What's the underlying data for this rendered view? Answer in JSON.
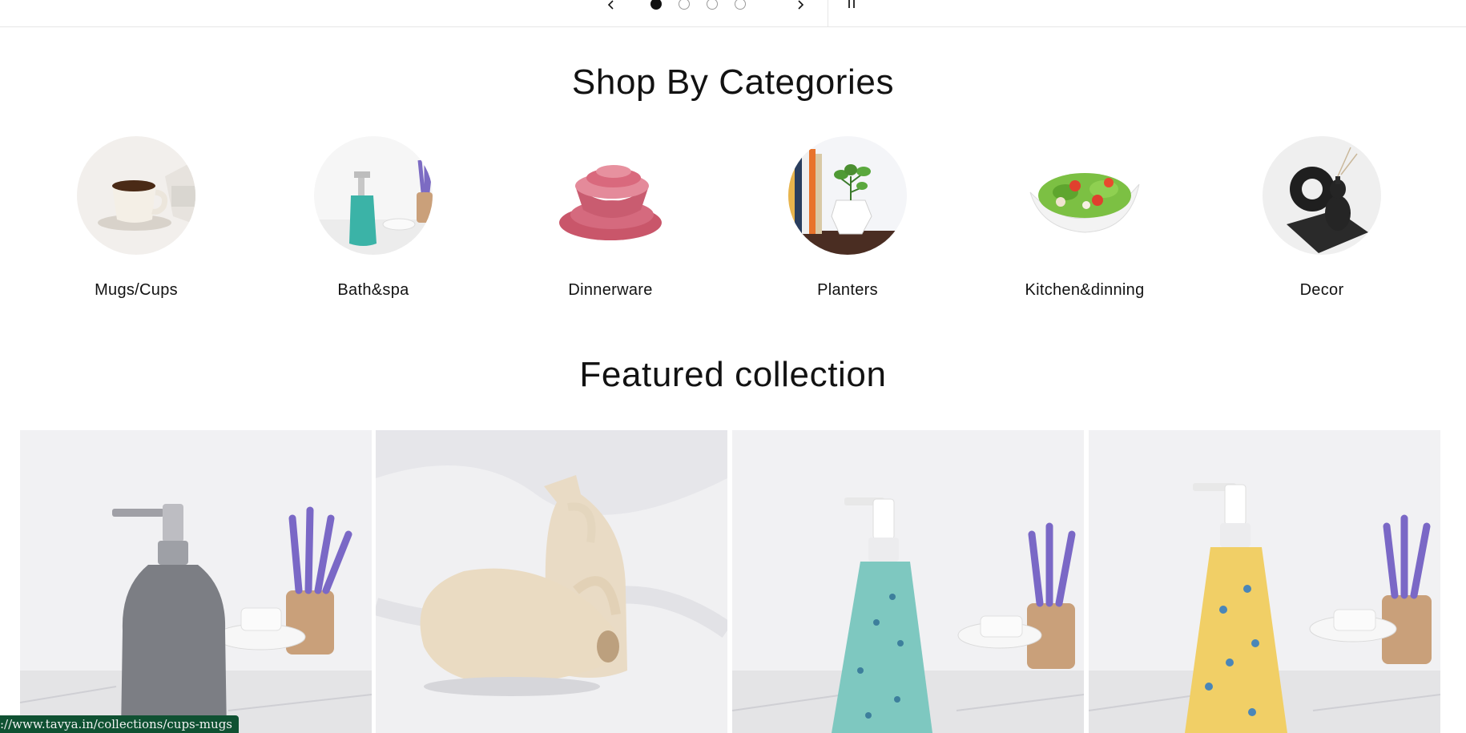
{
  "slideshow": {
    "prev_icon": "chevron-left-icon",
    "next_icon": "chevron-right-icon",
    "pause_icon": "pause-icon",
    "slide_count": 4,
    "active_slide": 1
  },
  "categories": {
    "title": "Shop By Categories",
    "items": [
      {
        "label": "Mugs/Cups"
      },
      {
        "label": "Bath&spa"
      },
      {
        "label": "Dinnerware"
      },
      {
        "label": "Planters"
      },
      {
        "label": "Kitchen&dinning"
      },
      {
        "label": "Decor"
      }
    ]
  },
  "featured": {
    "title": "Featured collection",
    "products": [
      {
        "image": "grey-soap-dispenser"
      },
      {
        "image": "beige-ceramic-jugs"
      },
      {
        "image": "teal-floral-soap-dispenser"
      },
      {
        "image": "yellow-floral-soap-dispenser"
      }
    ]
  },
  "status_bar": {
    "url": "://www.tavya.in/collections/cups-mugs"
  },
  "colors": {
    "text": "#121212",
    "status_bar_bg": "#0f5132"
  }
}
